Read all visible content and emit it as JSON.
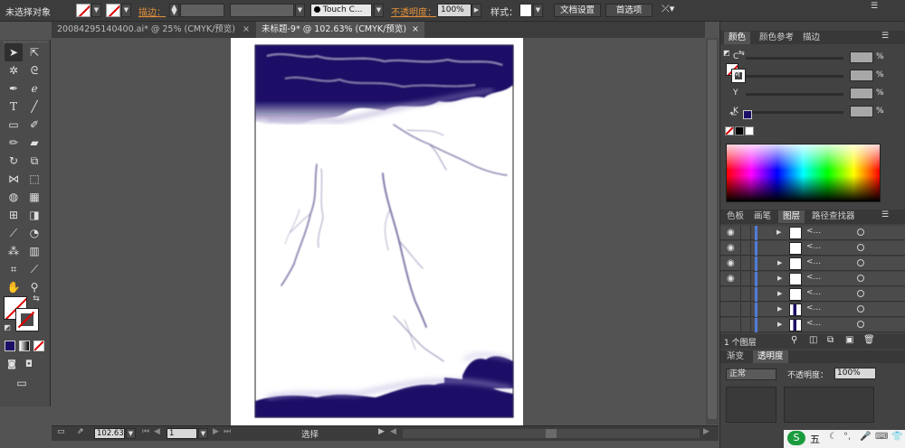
{
  "control_bar": {
    "selection_status": "未选择对象",
    "stroke_label": "描边：",
    "brush_name": "Touch C...",
    "opacity_label": "不透明度：",
    "opacity_value": "100%",
    "style_label": "样式：",
    "doc_settings_button": "文档设置",
    "preferences_button": "首选项"
  },
  "doc_tabs": [
    {
      "label": "20084295140400.ai* @ 25% (CMYK/预览)",
      "active": false
    },
    {
      "label": "未标题-9* @ 102.63% (CMYK/预览)",
      "active": true
    }
  ],
  "tab_close": "×",
  "statusbar": {
    "zoom": "102.63",
    "page": "1",
    "tool_status": "选择"
  },
  "color_panel": {
    "tabs": [
      "颜色",
      "颜色参考",
      "描边"
    ],
    "channels": [
      {
        "label": "C",
        "pct": "%"
      },
      {
        "label": "M",
        "pct": "%"
      },
      {
        "label": "Y",
        "pct": "%"
      },
      {
        "label": "K",
        "pct": "%"
      }
    ],
    "out_of_gamut_color": "#1a0f66"
  },
  "layers_panel": {
    "tabs": [
      "色板",
      "画笔",
      "图层",
      "路径查找器"
    ],
    "rows": [
      {
        "name": "<...",
        "eye": true,
        "expand": "right",
        "thumb": "white"
      },
      {
        "name": "<...",
        "eye": true,
        "expand": "none",
        "thumb": "white"
      },
      {
        "name": "<...",
        "eye": true,
        "expand": "right",
        "thumb": "white"
      },
      {
        "name": "<...",
        "eye": true,
        "expand": "right",
        "thumb": "white"
      },
      {
        "name": "<...",
        "eye": false,
        "expand": "right",
        "thumb": "white"
      },
      {
        "name": "<...",
        "eye": false,
        "expand": "right",
        "thumb": "navy"
      },
      {
        "name": "<...",
        "eye": false,
        "expand": "right",
        "thumb": "navy"
      }
    ],
    "footer_count": "1 个图层"
  },
  "gradient_panel": {
    "tabs": [
      "渐变",
      "透明度"
    ],
    "blend_mode": "正常",
    "opacity_label": "不透明度：",
    "opacity_value": "100%"
  },
  "taskbar": {
    "ime_label": "五"
  },
  "colors": {
    "storm_navy": "#1a0f66",
    "ui_dark": "#3c3c3c",
    "ui_mid": "#535353",
    "accent_orange": "#e3913a"
  }
}
